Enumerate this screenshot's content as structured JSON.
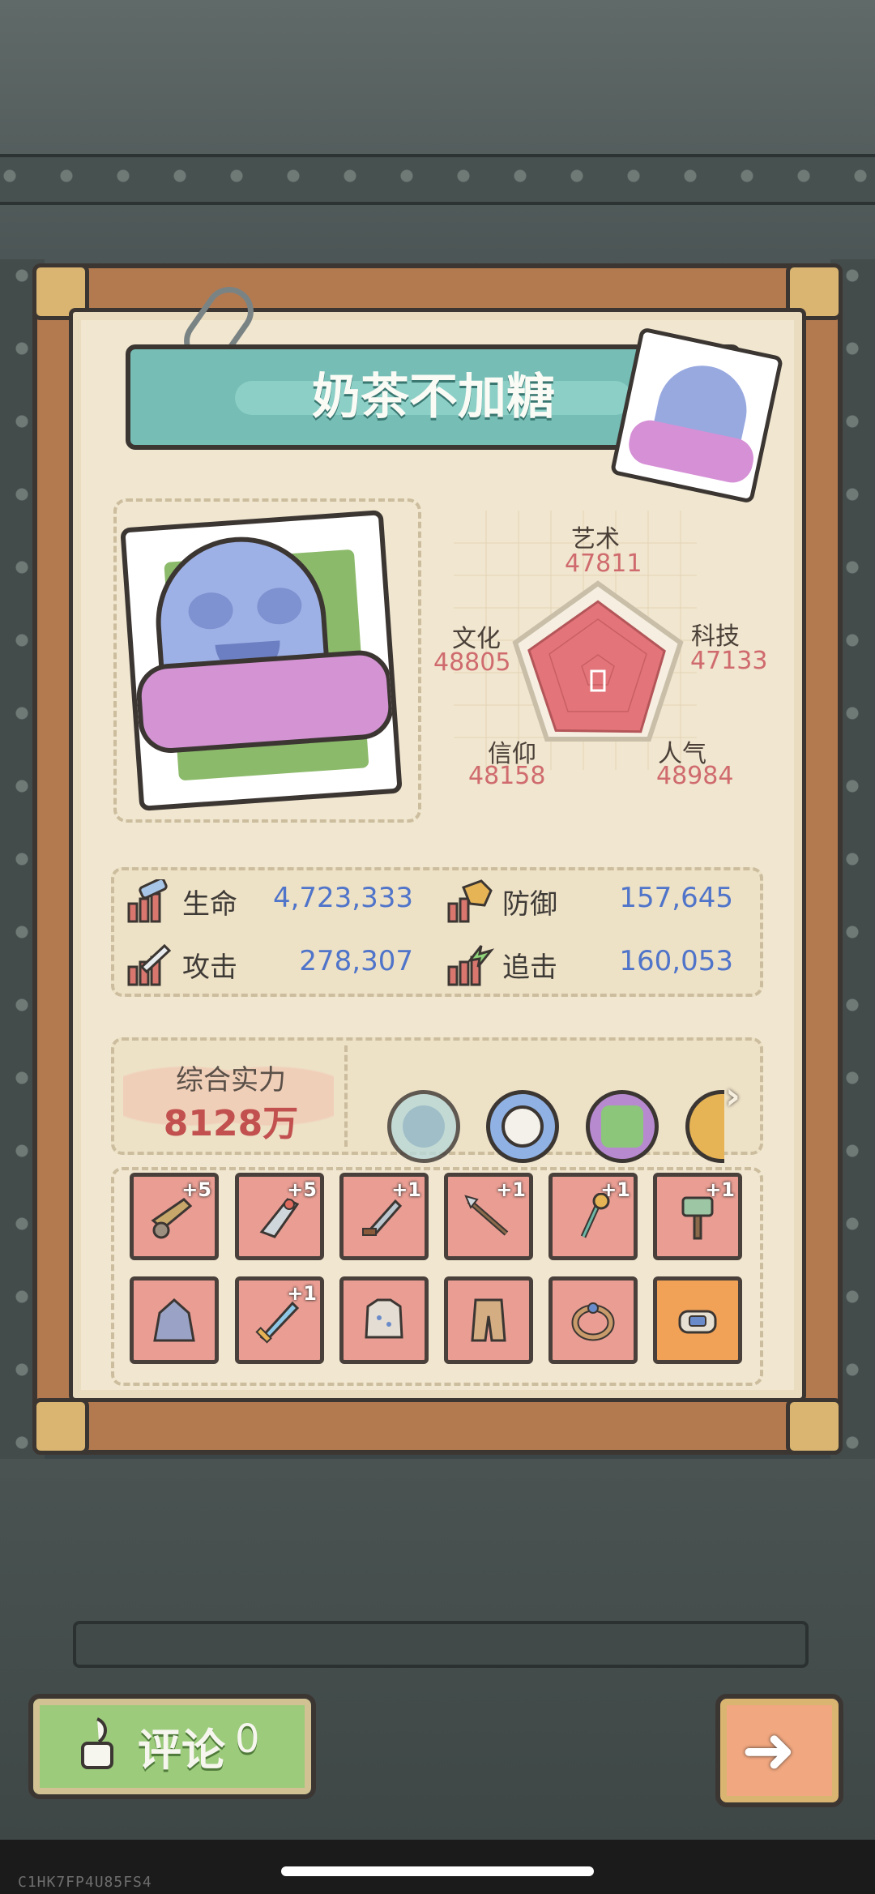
{
  "character": {
    "name": "奶茶不加糖"
  },
  "radar": {
    "art_label": "艺术",
    "art_value": "47811",
    "tech_label": "科技",
    "tech_value": "47133",
    "culture_label": "文化",
    "culture_value": "48805",
    "faith_label": "信仰",
    "faith_value": "48158",
    "popularity_label": "人气",
    "popularity_value": "48984",
    "scores": {
      "art": 47811,
      "tech": 47133,
      "popularity": 48984,
      "faith": 48158,
      "culture": 48805
    }
  },
  "stats": [
    {
      "label": "生命",
      "value": "4,723,333",
      "icon": "hp-icon"
    },
    {
      "label": "防御",
      "value": "157,645",
      "icon": "shield-icon"
    },
    {
      "label": "攻击",
      "value": "278,307",
      "icon": "sword-icon"
    },
    {
      "label": "追击",
      "value": "160,053",
      "icon": "lightning-icon"
    }
  ],
  "power": {
    "label": "综合实力",
    "value": "8128万"
  },
  "equipment": {
    "row1": [
      {
        "icon": "cannon-icon",
        "level": "+5"
      },
      {
        "icon": "rocket-icon",
        "level": "+5"
      },
      {
        "icon": "knife-icon",
        "level": "+1"
      },
      {
        "icon": "spear-icon",
        "level": "+1"
      },
      {
        "icon": "staff-icon",
        "level": "+1"
      },
      {
        "icon": "hammer-icon",
        "level": "+1"
      }
    ],
    "row2": [
      {
        "icon": "cloak-icon",
        "level": ""
      },
      {
        "icon": "sword-icon",
        "level": "+1"
      },
      {
        "icon": "armor-icon",
        "level": ""
      },
      {
        "icon": "pants-icon",
        "level": ""
      },
      {
        "icon": "ring-icon",
        "level": ""
      },
      {
        "icon": "bracelet-icon",
        "level": ""
      }
    ]
  },
  "buttons": {
    "comment_label": "评论",
    "comment_count": "0"
  },
  "footer": {
    "watermark": "C1HK7FP4U85FS4"
  },
  "colors": {
    "stat_value": "#4f74c9",
    "radar_value": "#cf6b6e",
    "power_value": "#c1504e",
    "banner": "#76bdb5",
    "comment_button": "#9ccb7b",
    "next_button": "#f1a77f"
  }
}
